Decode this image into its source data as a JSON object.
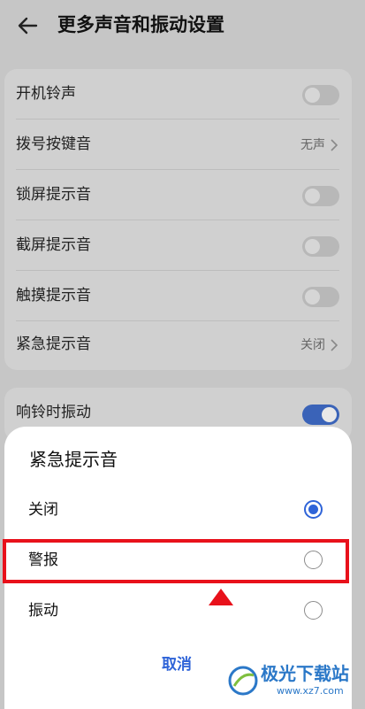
{
  "header": {
    "title": "更多声音和振动设置"
  },
  "settings": [
    {
      "label": "开机铃声",
      "type": "toggle",
      "on": false
    },
    {
      "label": "拨号按键音",
      "type": "value",
      "value": "无声"
    },
    {
      "label": "锁屏提示音",
      "type": "toggle",
      "on": false
    },
    {
      "label": "截屏提示音",
      "type": "toggle",
      "on": false
    },
    {
      "label": "触摸提示音",
      "type": "toggle",
      "on": false
    },
    {
      "label": "紧急提示音",
      "type": "value",
      "value": "关闭"
    }
  ],
  "vibration": {
    "label": "响铃时振动",
    "on": true
  },
  "sheet": {
    "title": "紧急提示音",
    "options": [
      {
        "label": "关闭",
        "selected": true
      },
      {
        "label": "警报",
        "selected": false
      },
      {
        "label": "振动",
        "selected": false
      }
    ],
    "cancel": "取消"
  },
  "watermark": {
    "text": "极光下载站",
    "url": "www.xz7.com"
  },
  "colors": {
    "accent": "#2f64d8",
    "highlight": "#e8111b"
  }
}
